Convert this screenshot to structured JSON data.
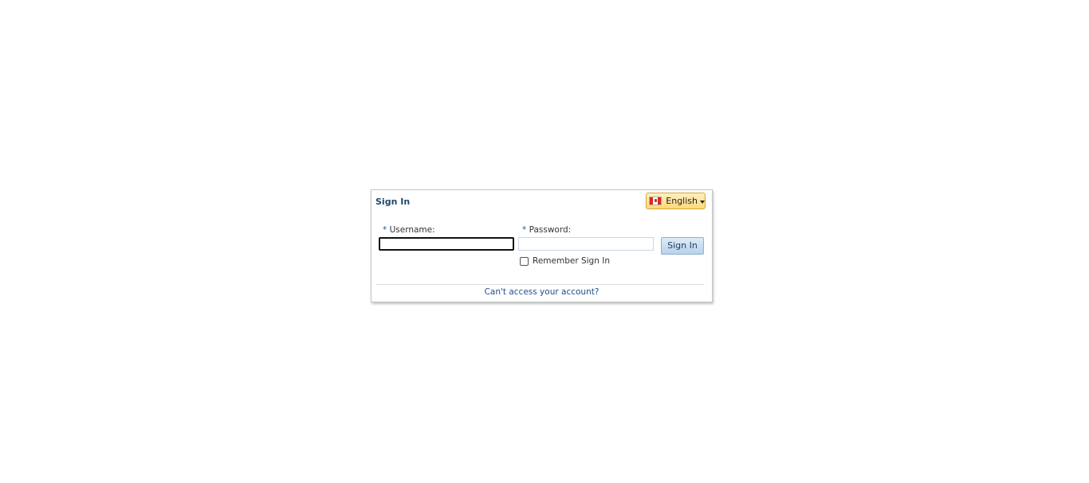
{
  "login": {
    "title": "Sign In",
    "language": {
      "selected": "English",
      "flag_icon": "canada-flag-icon"
    },
    "username": {
      "required_marker": "*",
      "label": "Username:",
      "value": "",
      "placeholder": ""
    },
    "password": {
      "required_marker": "*",
      "label": "Password:",
      "value": "",
      "placeholder": ""
    },
    "sign_in_label": "Sign In",
    "remember_label": "Remember Sign In",
    "remember_checked": false,
    "help_link": "Can't access your account?"
  },
  "colors": {
    "title": "#1a4a6b",
    "link": "#1f4e8c",
    "button_bg": "#b9d2ea",
    "language_bg": "#ffd976"
  }
}
